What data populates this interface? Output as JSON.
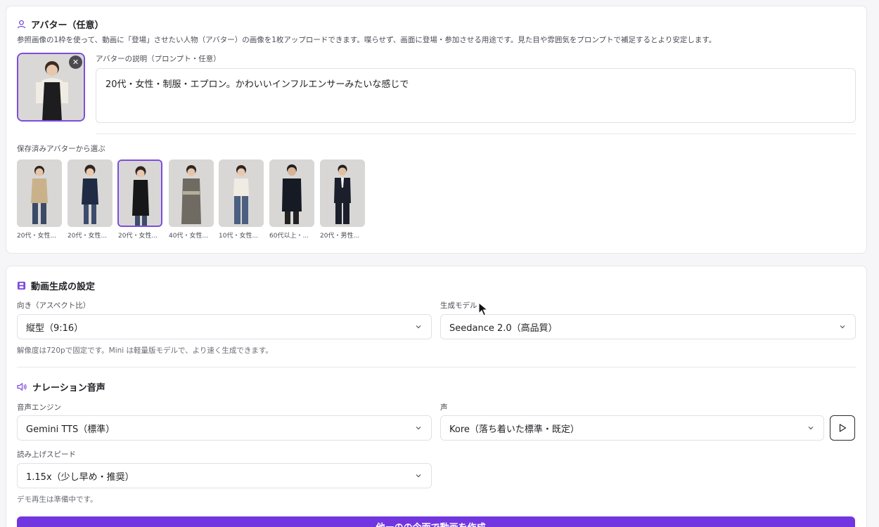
{
  "avatar_section": {
    "title": "アバター（任意）",
    "description": "参照画像の1枠を使って、動画に「登場」させたい人物（アバター）の画像を1枚アップロードできます。喋らせず、画面に登場・参加させる用途です。見た目や雰囲気をプロンプトで補足するとより安定します。",
    "prompt_label": "アバターの説明（プロンプト・任意）",
    "prompt_value": "20代・女性・制服・エプロン。かわいいインフルエンサーみたいな感じで",
    "saved_label": "保存済みアバターから選ぶ",
    "saved_avatars": [
      {
        "caption": "20代・女性..."
      },
      {
        "caption": "20代・女性..."
      },
      {
        "caption": "20代・女性..."
      },
      {
        "caption": "40代・女性..."
      },
      {
        "caption": "10代・女性..."
      },
      {
        "caption": "60代以上・..."
      },
      {
        "caption": "20代・男性..."
      }
    ],
    "selected_index": 2
  },
  "video_section": {
    "title": "動画生成の設定",
    "orientation_label": "向き（アスペクト比）",
    "orientation_value": "縦型（9:16）",
    "model_label": "生成モデル",
    "model_value": "Seedance 2.0（高品質）",
    "resolution_hint": "解像度は720pで固定です。Mini は軽量版モデルで、より速く生成できます。"
  },
  "narration_section": {
    "title": "ナレーション音声",
    "engine_label": "音声エンジン",
    "engine_value": "Gemini TTS（標準）",
    "voice_label": "声",
    "voice_value": "Kore（落ち着いた標準・既定）",
    "speed_label": "読み上げスピード",
    "speed_value": "1.15x（少し早め・推奨）",
    "demo_hint": "デモ再生は準備中です。"
  },
  "primary_button": {
    "label": "他ーのの今面で動画を作成..."
  },
  "colors": {
    "accent": "#7c4ddb",
    "primary_button": "#7236e0"
  }
}
